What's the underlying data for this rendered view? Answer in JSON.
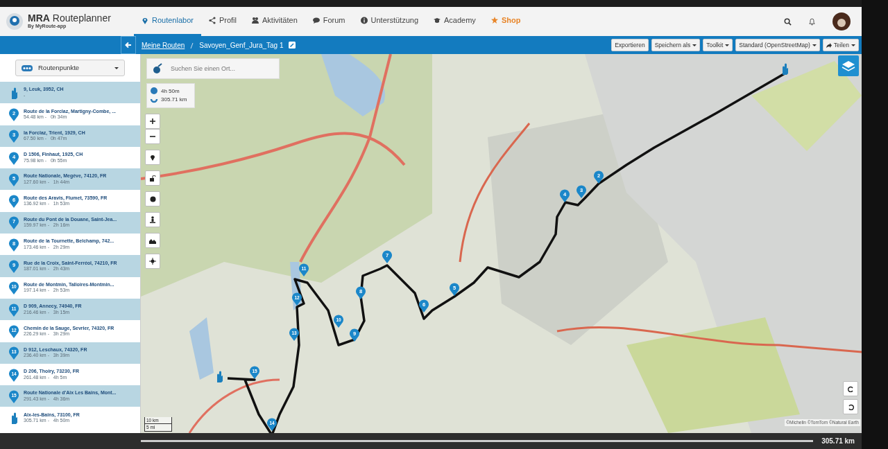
{
  "app": {
    "title": "MRA Routeplanner",
    "subtitle": "By MyRoute-app"
  },
  "nav": [
    {
      "label": "Routenlabor",
      "kind": "link",
      "selected": true
    },
    {
      "label": "Profil",
      "kind": "link",
      "selected": false
    },
    {
      "label": "Aktivitäten",
      "kind": "link",
      "selected": false
    },
    {
      "label": "Forum",
      "kind": "link",
      "selected": false
    },
    {
      "label": "Unterstützung",
      "kind": "link",
      "selected": false
    },
    {
      "label": "Academy",
      "kind": "link",
      "selected": false
    },
    {
      "label": "Shop",
      "kind": "promo",
      "selected": false
    }
  ],
  "breadcrumb": [
    "Meine Routen",
    "Savoyen_Genf_Jura_Tag 1"
  ],
  "toolbar": [
    {
      "label": "Exportieren",
      "dropdown": false,
      "kind": "plain"
    },
    {
      "label": "Speichern als",
      "dropdown": true,
      "kind": "plain"
    },
    {
      "label": "Toolkit",
      "dropdown": true,
      "kind": "plain"
    },
    {
      "label": "Standard (OpenStreetMap)",
      "dropdown": true,
      "kind": "plain"
    },
    {
      "label": "Teilen",
      "dropdown": true,
      "kind": "share"
    }
  ],
  "sidebar": {
    "select": "Routenpunkte",
    "waypoints": [
      {
        "kind": "start",
        "name": "9, Leuk, 3952, CH",
        "info": "-"
      },
      {
        "kind": "via",
        "number": "2",
        "name": "Route de la Forclaz, Martigny-Combe, ...",
        "info": "54.48 km -   0h 34m"
      },
      {
        "kind": "via",
        "number": "3",
        "name": "la Forclaz, Trient, 1929, CH",
        "info": "67.50 km -   0h 47m"
      },
      {
        "kind": "via",
        "number": "4",
        "name": "D 1506, Finhaut, 1925, CH",
        "info": "75.98 km -   0h 55m"
      },
      {
        "kind": "via",
        "number": "5",
        "name": "Route Nationale, Megève, 74120, FR",
        "info": "127.60 km -   1h 44m"
      },
      {
        "kind": "via",
        "number": "6",
        "name": "Route des Aravis, Flumet, 73590, FR",
        "info": "136.92 km -   1h 53m"
      },
      {
        "kind": "via",
        "number": "7",
        "name": "Route du Pont de la Douane, Saint-Jea...",
        "info": "159.97 km -   2h 16m"
      },
      {
        "kind": "via",
        "number": "8",
        "name": "Route de la Tournette, Belchamp, 742...",
        "info": "173.46 km -   2h 29m"
      },
      {
        "kind": "via",
        "number": "9",
        "name": "Rue de la Croix, Saint-Ferréol, 74210, FR",
        "info": "187.01 km -   2h 43m"
      },
      {
        "kind": "via",
        "number": "10",
        "name": "Route de Montmin, Talloires-Montmin...",
        "info": "197.14 km -   2h 53m"
      },
      {
        "kind": "via",
        "number": "11",
        "name": "D 909, Annecy, 74940, FR",
        "info": "216.46 km -   3h 15m"
      },
      {
        "kind": "via",
        "number": "12",
        "name": "Chemin de la Sauge, Sevrier, 74320, FR",
        "info": "226.29 km -   3h 29m"
      },
      {
        "kind": "via",
        "number": "13",
        "name": "D 912, Leschaux, 74320, FR",
        "info": "236.40 km -   3h 39m"
      },
      {
        "kind": "via",
        "number": "14",
        "name": "D 206, Thoiry, 73230, FR",
        "info": "261.48 km -   4h 5m"
      },
      {
        "kind": "via",
        "number": "15",
        "name": "Route Nationale d'Aix Les Bains, Mont...",
        "info": "291.43 km -   4h 36m"
      },
      {
        "kind": "end",
        "name": "Aix-les-Bains, 73100, FR",
        "info": "305.71 km -   4h 50m"
      }
    ]
  },
  "map": {
    "markers": [
      {
        "kind": "start"
      },
      {
        "kind": "via",
        "number": "2"
      },
      {
        "kind": "via",
        "number": "3"
      },
      {
        "kind": "via",
        "number": "4"
      },
      {
        "kind": "via",
        "number": "5"
      },
      {
        "kind": "via",
        "number": "6"
      },
      {
        "kind": "via",
        "number": "7"
      },
      {
        "kind": "via",
        "number": "8"
      },
      {
        "kind": "via",
        "number": "9"
      },
      {
        "kind": "via",
        "number": "10"
      },
      {
        "kind": "via",
        "number": "11"
      },
      {
        "kind": "via",
        "number": "12"
      },
      {
        "kind": "via",
        "number": "13"
      },
      {
        "kind": "via",
        "number": "14"
      },
      {
        "kind": "via",
        "number": "15"
      },
      {
        "kind": "end"
      }
    ],
    "search_placeholder": "Suchen Sie einen Ort...",
    "duration": "4h 50m",
    "distance": "305.71 km",
    "scale": [
      "10 km",
      "5 mi"
    ],
    "attribution": "©Michelin ©TomTom ©Natural Earth"
  },
  "elevation_bar": {
    "distance": "305.71 km"
  }
}
